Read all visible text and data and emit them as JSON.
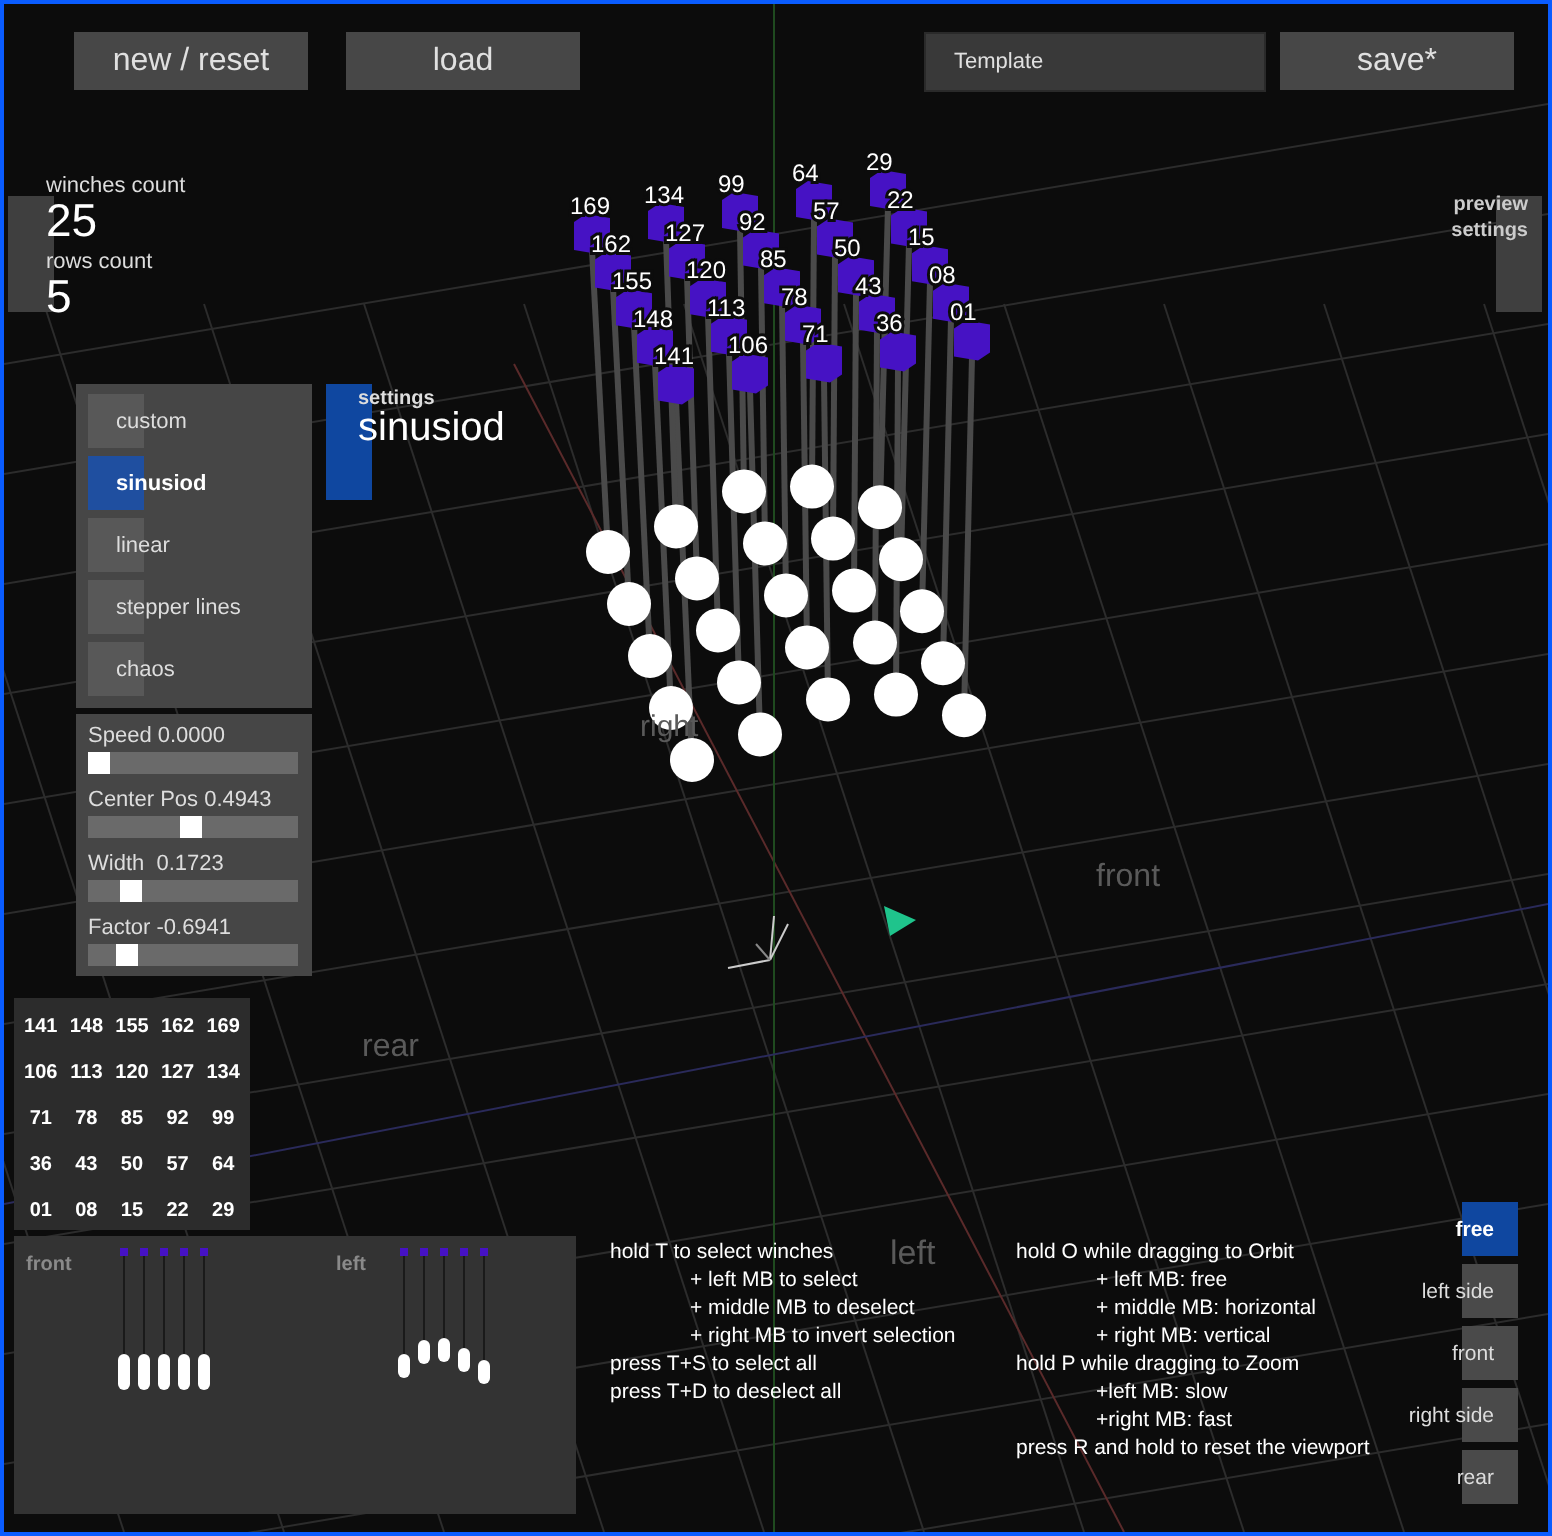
{
  "top_bar": {
    "buttons": [
      "new / reset",
      "load"
    ],
    "template_field": {
      "value": "Template"
    },
    "save_button": "save*"
  },
  "counts": [
    {
      "label": "winches count",
      "value": "25"
    },
    {
      "label": "rows count",
      "value": "5"
    }
  ],
  "preview_settings": "preview settings",
  "modes": [
    {
      "label": "custom",
      "selected": false
    },
    {
      "label": "sinusiod",
      "selected": true
    },
    {
      "label": "linear",
      "selected": false
    },
    {
      "label": "stepper lines",
      "selected": false
    },
    {
      "label": "chaos",
      "selected": false
    }
  ],
  "settings": {
    "label": "settings",
    "value": "sinusiod"
  },
  "sliders": [
    {
      "label": "Speed 0.0000",
      "level": 0.0
    },
    {
      "label": "Center Pos 0.4943",
      "level": 0.49
    },
    {
      "label": "Width  0.1723",
      "level": 0.17
    },
    {
      "label": "Factor -0.6941",
      "level": 0.15
    }
  ],
  "winch_grid": [
    [
      "141",
      "148",
      "155",
      "162",
      "169"
    ],
    [
      "106",
      "113",
      "120",
      "127",
      "134"
    ],
    [
      "71",
      "78",
      "85",
      "92",
      "99"
    ],
    [
      "36",
      "43",
      "50",
      "57",
      "64"
    ],
    [
      "01",
      "08",
      "15",
      "22",
      "29"
    ]
  ],
  "previews": [
    {
      "title": "front"
    },
    {
      "title": "left"
    }
  ],
  "scene": {
    "winch_columns": [
      [
        "169",
        "162",
        "155",
        "148",
        "141"
      ],
      [
        "134",
        "127",
        "120",
        "113",
        "106"
      ],
      [
        "99",
        "92",
        "85",
        "78",
        "71"
      ],
      [
        "64",
        "57",
        "50",
        "43",
        "36"
      ],
      [
        "29",
        "22",
        "15",
        "08",
        "01"
      ]
    ],
    "direction_labels": [
      "right",
      "front",
      "rear",
      "left"
    ]
  },
  "help_left": [
    {
      "text": "hold T to select winches",
      "kind": "main"
    },
    {
      "text": "+ left MB to select",
      "kind": "sub"
    },
    {
      "text": "+ middle MB to deselect",
      "kind": "sub"
    },
    {
      "text": "+ right MB to invert selection",
      "kind": "sub"
    },
    {
      "text": "press T+S  to select all",
      "kind": "main"
    },
    {
      "text": "press T+D to deselect all",
      "kind": "main"
    }
  ],
  "help_right": [
    {
      "text": "hold O while dragging to Orbit",
      "kind": "main"
    },
    {
      "text": "+ left MB: free",
      "kind": "sub"
    },
    {
      "text": "+ middle MB: horizontal",
      "kind": "sub"
    },
    {
      "text": "+ right MB: vertical",
      "kind": "sub"
    },
    {
      "text": "hold P while dragging to Zoom",
      "kind": "main"
    },
    {
      "text": "+left MB: slow",
      "kind": "sub"
    },
    {
      "text": "+right MB: fast",
      "kind": "sub"
    },
    {
      "text": "press R and hold to reset the viewport",
      "kind": "main"
    }
  ],
  "views": [
    {
      "label": "free",
      "selected": true
    },
    {
      "label": "left side",
      "selected": false
    },
    {
      "label": "front",
      "selected": false
    },
    {
      "label": "right side",
      "selected": false
    },
    {
      "label": "rear",
      "selected": false
    }
  ]
}
